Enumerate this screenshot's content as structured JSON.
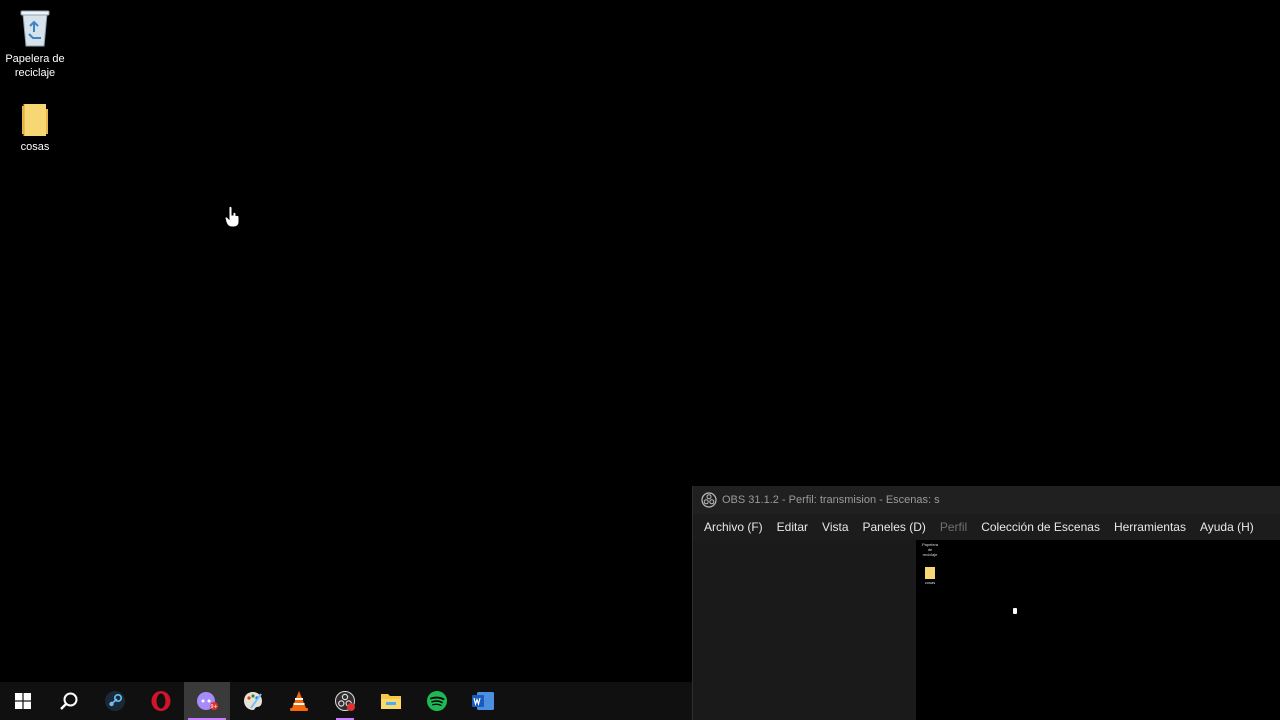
{
  "desktop": {
    "icons": [
      {
        "label_line1": "Papelera de",
        "label_line2": "reciclaje"
      },
      {
        "label": "cosas"
      }
    ]
  },
  "obs": {
    "title": "OBS 31.1.2 - Perfil: transmision - Escenas: s",
    "menu": [
      {
        "label": "Archivo (F)"
      },
      {
        "label": "Editar"
      },
      {
        "label": "Vista"
      },
      {
        "label": "Paneles (D)"
      },
      {
        "label": "Perfil",
        "disabled": true
      },
      {
        "label": "Colección de Escenas"
      },
      {
        "label": "Herramientas"
      },
      {
        "label": "Ayuda (H)"
      }
    ],
    "preview": {
      "recycle_label": "Papelera de reciclaje",
      "folder_label": "cosas"
    }
  },
  "taskbar": {
    "items": [
      {
        "icon": "windows-start-icon"
      },
      {
        "icon": "search-icon"
      },
      {
        "icon": "steam-icon"
      },
      {
        "icon": "opera-icon"
      },
      {
        "icon": "discord-icon",
        "badge": "9+",
        "active": true
      },
      {
        "icon": "paint-icon"
      },
      {
        "icon": "vlc-icon"
      },
      {
        "icon": "obs-icon",
        "running": true
      },
      {
        "icon": "file-explorer-icon"
      },
      {
        "icon": "spotify-icon"
      },
      {
        "icon": "word-icon"
      }
    ]
  },
  "colors": {
    "accent": "#c77dff",
    "desktop_bg": "#000000",
    "taskbar_bg": "#101010",
    "obs_bg": "#1c1c1c"
  }
}
